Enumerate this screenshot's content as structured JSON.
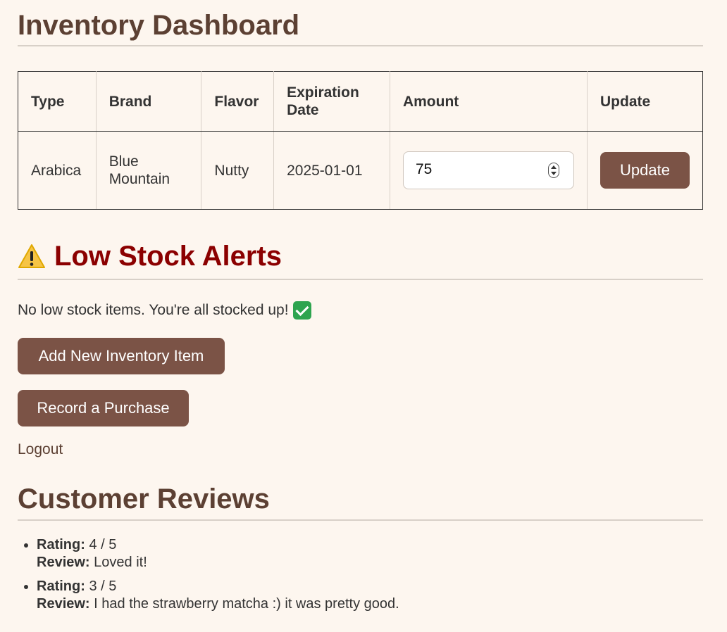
{
  "page": {
    "title": "Inventory Dashboard"
  },
  "table": {
    "headers": [
      "Type",
      "Brand",
      "Flavor",
      "Expiration Date",
      "Amount",
      "Update"
    ],
    "rows": [
      {
        "type": "Arabica",
        "brand": "Blue Mountain",
        "flavor": "Nutty",
        "expiration": "2025-01-01",
        "amount": "75",
        "update_label": "Update"
      }
    ]
  },
  "alerts": {
    "heading": "Low Stock Alerts",
    "icon": "warning-icon",
    "message": "No low stock items. You're all stocked up!",
    "message_icon": "check-icon"
  },
  "actions": {
    "add_label": "Add New Inventory Item",
    "record_label": "Record a Purchase",
    "logout_label": "Logout"
  },
  "reviews": {
    "heading": "Customer Reviews",
    "rating_label": "Rating:",
    "review_label": "Review:",
    "items": [
      {
        "rating": "4 / 5",
        "review": "Loved it!"
      },
      {
        "rating": "3 / 5",
        "review": "I had the strawberry matcha :) it was pretty good."
      }
    ]
  },
  "colors": {
    "background": "#fdf6ef",
    "heading": "#5c4033",
    "alert": "#8b0000",
    "button": "#7b5346"
  }
}
